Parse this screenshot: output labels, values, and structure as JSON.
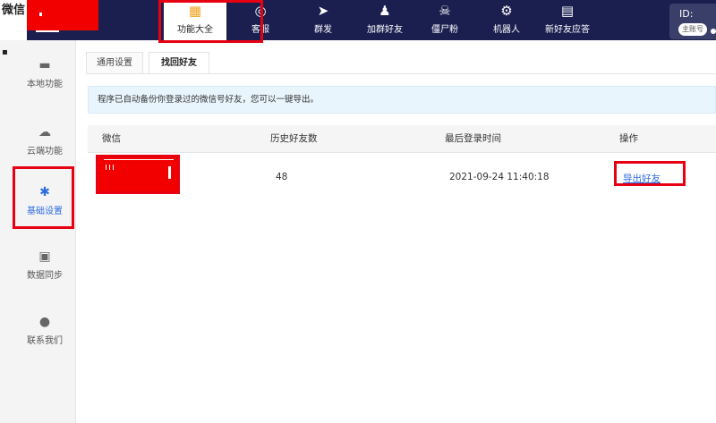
{
  "window": {
    "title_fragment": "微信"
  },
  "topnav": {
    "items": [
      {
        "label": "功能大全",
        "icon": "grid-icon"
      },
      {
        "label": "客服",
        "icon": "headset-icon"
      },
      {
        "label": "群发",
        "icon": "send-icon"
      },
      {
        "label": "加群好友",
        "icon": "add-user-icon"
      },
      {
        "label": "僵尸粉",
        "icon": "skull-icon"
      },
      {
        "label": "机器人",
        "icon": "robot-icon"
      },
      {
        "label": "新好友应答",
        "icon": "chat-icon"
      }
    ],
    "id_label": "ID:",
    "account_badge": "主账号"
  },
  "sidebar": {
    "items": [
      {
        "label": "本地功能",
        "icon": "monitor-icon"
      },
      {
        "label": "云端功能",
        "icon": "cloud-icon"
      },
      {
        "label": "基础设置",
        "icon": "gear-icon"
      },
      {
        "label": "数据同步",
        "icon": "sync-icon"
      },
      {
        "label": "联系我们",
        "icon": "user-icon"
      }
    ],
    "active_index": 2
  },
  "tabs": [
    {
      "label": "通用设置"
    },
    {
      "label": "找回好友"
    }
  ],
  "notice": "程序已自动备份你登录过的微信号好友，您可以一键导出。",
  "table": {
    "headers": [
      "微信",
      "历史好友数",
      "最后登录时间",
      "操作"
    ],
    "rows": [
      {
        "friends": "48",
        "last_login": "2021-09-24 11:40:18",
        "action": "导出好友"
      }
    ]
  },
  "colors": {
    "topbar": "#1a1f4f",
    "accent": "#2d6be0",
    "highlight": "#e60012",
    "redaction": "#f20000"
  }
}
